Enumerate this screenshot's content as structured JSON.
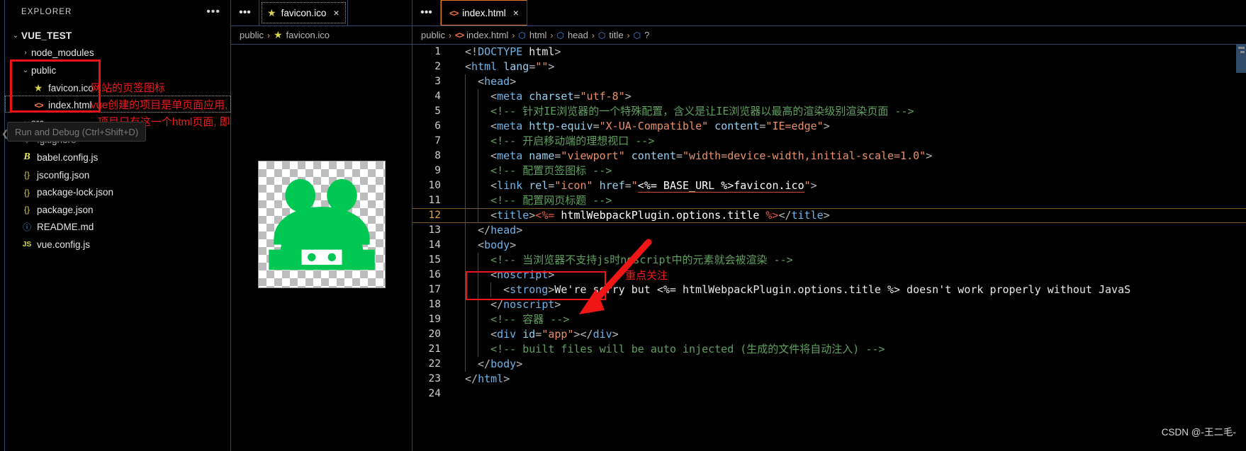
{
  "sidebar": {
    "header": {
      "title": "EXPLORER",
      "overflow_icon": "ellipsis-icon"
    },
    "root": {
      "label": "VUE_TEST",
      "chevron": "chevron-down-icon"
    },
    "items": [
      {
        "label": "node_modules",
        "icon": "folder",
        "chevron": "chevron-right-icon",
        "indent": 1
      },
      {
        "label": "public",
        "icon": "folder",
        "chevron": "chevron-down-icon",
        "indent": 1
      },
      {
        "label": "favicon.ico",
        "icon": "star-icon",
        "indent": 2
      },
      {
        "label": "index.html",
        "icon": "code-icon",
        "indent": 2
      },
      {
        "label": "src",
        "icon": "folder",
        "chevron": "chevron-right-icon",
        "indent": 1
      },
      {
        "label": ".gitignore",
        "icon": "git-icon",
        "indent": 1
      },
      {
        "label": "babel.config.js",
        "icon": "babel-icon",
        "indent": 1
      },
      {
        "label": "jsconfig.json",
        "icon": "json-icon",
        "indent": 1
      },
      {
        "label": "package-lock.json",
        "icon": "json-icon",
        "indent": 1
      },
      {
        "label": "package.json",
        "icon": "json-icon",
        "indent": 1
      },
      {
        "label": "README.md",
        "icon": "info-icon",
        "indent": 1
      },
      {
        "label": "vue.config.js",
        "icon": "js-icon",
        "indent": 1
      }
    ],
    "annotations": [
      "网站的页签图标",
      "vue创建的项目是单页面应用,",
      "项目只有这一个html页面, 即index.html"
    ],
    "tooltip": "Run and Debug (Ctrl+Shift+D)"
  },
  "middle_pane": {
    "overflow_icon": "ellipsis-icon",
    "tab": {
      "label": "favicon.ico",
      "icon": "star-icon",
      "close": "×"
    },
    "breadcrumb": {
      "folder": "public",
      "separator": "›",
      "file": "favicon.ico",
      "file_icon": "star-icon"
    }
  },
  "editor_pane": {
    "overflow_icon": "ellipsis-icon",
    "tab": {
      "label": "index.html",
      "icon": "code-icon",
      "close": "×"
    },
    "breadcrumb": [
      {
        "label": "public",
        "icon": "none"
      },
      {
        "label": "index.html",
        "icon": "code-icon"
      },
      {
        "label": "html",
        "icon": "cube-icon"
      },
      {
        "label": "head",
        "icon": "cube-icon"
      },
      {
        "label": "title",
        "icon": "cube-icon"
      },
      {
        "label": "?",
        "icon": "cube-icon"
      }
    ],
    "separator": "›",
    "current_line": 12,
    "annotation": "重点关注",
    "watermark": "CSDN @-王二毛-",
    "lines": [
      {
        "n": 1,
        "tokens": [
          {
            "t": "punct",
            "s": "<!"
          },
          {
            "t": "tag",
            "s": "DOCTYPE"
          },
          {
            "t": "plain",
            "s": " html"
          },
          {
            "t": "punct",
            "s": ">"
          }
        ],
        "indent": 0
      },
      {
        "n": 2,
        "tokens": [
          {
            "t": "punct",
            "s": "<"
          },
          {
            "t": "tag",
            "s": "html"
          },
          {
            "t": "plain",
            "s": " "
          },
          {
            "t": "attr",
            "s": "lang"
          },
          {
            "t": "punct",
            "s": "="
          },
          {
            "t": "str",
            "s": "\"\""
          },
          {
            "t": "punct",
            "s": ">"
          }
        ],
        "indent": 0
      },
      {
        "n": 3,
        "tokens": [
          {
            "t": "punct",
            "s": "<"
          },
          {
            "t": "tag",
            "s": "head"
          },
          {
            "t": "punct",
            "s": ">"
          }
        ],
        "indent": 1
      },
      {
        "n": 4,
        "tokens": [
          {
            "t": "punct",
            "s": "<"
          },
          {
            "t": "tag",
            "s": "meta"
          },
          {
            "t": "plain",
            "s": " "
          },
          {
            "t": "attr",
            "s": "charset"
          },
          {
            "t": "punct",
            "s": "="
          },
          {
            "t": "str",
            "s": "\"utf-8\""
          },
          {
            "t": "punct",
            "s": ">"
          }
        ],
        "indent": 2
      },
      {
        "n": 5,
        "tokens": [
          {
            "t": "cmt",
            "s": "<!-- 针对IE浏览器的一个特殊配置，含义是让IE浏览器以最高的渲染级别渲染页面 -->"
          }
        ],
        "indent": 2
      },
      {
        "n": 6,
        "tokens": [
          {
            "t": "punct",
            "s": "<"
          },
          {
            "t": "tag",
            "s": "meta"
          },
          {
            "t": "plain",
            "s": " "
          },
          {
            "t": "attr",
            "s": "http-equiv"
          },
          {
            "t": "punct",
            "s": "="
          },
          {
            "t": "str",
            "s": "\"X-UA-Compatible\""
          },
          {
            "t": "plain",
            "s": " "
          },
          {
            "t": "attr",
            "s": "content"
          },
          {
            "t": "punct",
            "s": "="
          },
          {
            "t": "str",
            "s": "\"IE=edge\""
          },
          {
            "t": "punct",
            "s": ">"
          }
        ],
        "indent": 2
      },
      {
        "n": 7,
        "tokens": [
          {
            "t": "cmt",
            "s": "<!-- 开启移动端的理想视口 -->"
          }
        ],
        "indent": 2
      },
      {
        "n": 8,
        "tokens": [
          {
            "t": "punct",
            "s": "<"
          },
          {
            "t": "tag",
            "s": "meta"
          },
          {
            "t": "plain",
            "s": " "
          },
          {
            "t": "attr",
            "s": "name"
          },
          {
            "t": "punct",
            "s": "="
          },
          {
            "t": "str",
            "s": "\"viewport\""
          },
          {
            "t": "plain",
            "s": " "
          },
          {
            "t": "attr",
            "s": "content"
          },
          {
            "t": "punct",
            "s": "="
          },
          {
            "t": "str",
            "s": "\"width=device-width,initial-scale=1.0\""
          },
          {
            "t": "punct",
            "s": ">"
          }
        ],
        "indent": 2
      },
      {
        "n": 9,
        "tokens": [
          {
            "t": "cmt",
            "s": "<!-- 配置页签图标 -->"
          }
        ],
        "indent": 2
      },
      {
        "n": 10,
        "tokens": [
          {
            "t": "punct",
            "s": "<"
          },
          {
            "t": "tag",
            "s": "link"
          },
          {
            "t": "plain",
            "s": " "
          },
          {
            "t": "attr",
            "s": "rel"
          },
          {
            "t": "punct",
            "s": "="
          },
          {
            "t": "str",
            "s": "\"icon\""
          },
          {
            "t": "plain",
            "s": " "
          },
          {
            "t": "attr",
            "s": "href"
          },
          {
            "t": "punct",
            "s": "="
          },
          {
            "t": "str",
            "s": "\""
          },
          {
            "t": "ejsu",
            "s": "<%= BASE_URL %>favicon.ico"
          },
          {
            "t": "str",
            "s": "\""
          },
          {
            "t": "punct",
            "s": ">"
          }
        ],
        "indent": 2
      },
      {
        "n": 11,
        "tokens": [
          {
            "t": "cmt",
            "s": "<!-- 配置网页标题 -->"
          }
        ],
        "indent": 2
      },
      {
        "n": 12,
        "tokens": [
          {
            "t": "punct",
            "s": "<"
          },
          {
            "t": "tag",
            "s": "title"
          },
          {
            "t": "punct",
            "s": ">"
          },
          {
            "t": "red",
            "s": "<%="
          },
          {
            "t": "ejs",
            "s": " htmlWebpackPlugin.options.title "
          },
          {
            "t": "red",
            "s": "%>"
          },
          {
            "t": "punct",
            "s": "</"
          },
          {
            "t": "tag",
            "s": "title"
          },
          {
            "t": "punct",
            "s": ">"
          }
        ],
        "indent": 2
      },
      {
        "n": 13,
        "tokens": [
          {
            "t": "punct",
            "s": "</"
          },
          {
            "t": "tag",
            "s": "head"
          },
          {
            "t": "punct",
            "s": ">"
          }
        ],
        "indent": 1
      },
      {
        "n": 14,
        "tokens": [
          {
            "t": "punct",
            "s": "<"
          },
          {
            "t": "tag",
            "s": "body"
          },
          {
            "t": "punct",
            "s": ">"
          }
        ],
        "indent": 1
      },
      {
        "n": 15,
        "tokens": [
          {
            "t": "cmt",
            "s": "<!-- 当浏览器不支持js时noscript中的元素就会被渲染 -->"
          }
        ],
        "indent": 2
      },
      {
        "n": 16,
        "tokens": [
          {
            "t": "punct",
            "s": "<"
          },
          {
            "t": "tag",
            "s": "noscript"
          },
          {
            "t": "punct",
            "s": ">"
          }
        ],
        "indent": 2
      },
      {
        "n": 17,
        "tokens": [
          {
            "t": "punct",
            "s": "<"
          },
          {
            "t": "tag",
            "s": "strong"
          },
          {
            "t": "punct",
            "s": ">"
          },
          {
            "t": "plain",
            "s": "We're sorry but "
          },
          {
            "t": "plain",
            "s": "<%= htmlWebpackPlugin.options.title %> doesn't work properly without JavaS"
          }
        ],
        "indent": 3
      },
      {
        "n": 18,
        "tokens": [
          {
            "t": "punct",
            "s": "</"
          },
          {
            "t": "tag",
            "s": "noscript"
          },
          {
            "t": "punct",
            "s": ">"
          }
        ],
        "indent": 2
      },
      {
        "n": 19,
        "tokens": [
          {
            "t": "cmt",
            "s": "<!-- 容器 -->"
          }
        ],
        "indent": 2
      },
      {
        "n": 20,
        "tokens": [
          {
            "t": "punct",
            "s": "<"
          },
          {
            "t": "tag",
            "s": "div"
          },
          {
            "t": "plain",
            "s": " "
          },
          {
            "t": "attr",
            "s": "id"
          },
          {
            "t": "punct",
            "s": "="
          },
          {
            "t": "str",
            "s": "\"app\""
          },
          {
            "t": "punct",
            "s": "></"
          },
          {
            "t": "tag",
            "s": "div"
          },
          {
            "t": "punct",
            "s": ">"
          }
        ],
        "indent": 2
      },
      {
        "n": 21,
        "tokens": [
          {
            "t": "cmt",
            "s": "<!-- built files will be auto injected (生成的文件将自动注入) -->"
          }
        ],
        "indent": 2
      },
      {
        "n": 22,
        "tokens": [
          {
            "t": "punct",
            "s": "</"
          },
          {
            "t": "tag",
            "s": "body"
          },
          {
            "t": "punct",
            "s": ">"
          }
        ],
        "indent": 1
      },
      {
        "n": 23,
        "tokens": [
          {
            "t": "punct",
            "s": "</"
          },
          {
            "t": "tag",
            "s": "html"
          },
          {
            "t": "punct",
            "s": ">"
          }
        ],
        "indent": 0
      },
      {
        "n": 24,
        "tokens": [],
        "indent": 0
      }
    ]
  },
  "colors": {
    "accent_orange": "#e8792c",
    "annotation_red": "#f11a1a",
    "comment_green": "#5fa05f",
    "vue_green": "#00c853",
    "background": "#000000",
    "border_blue": "#2b4a6b"
  }
}
